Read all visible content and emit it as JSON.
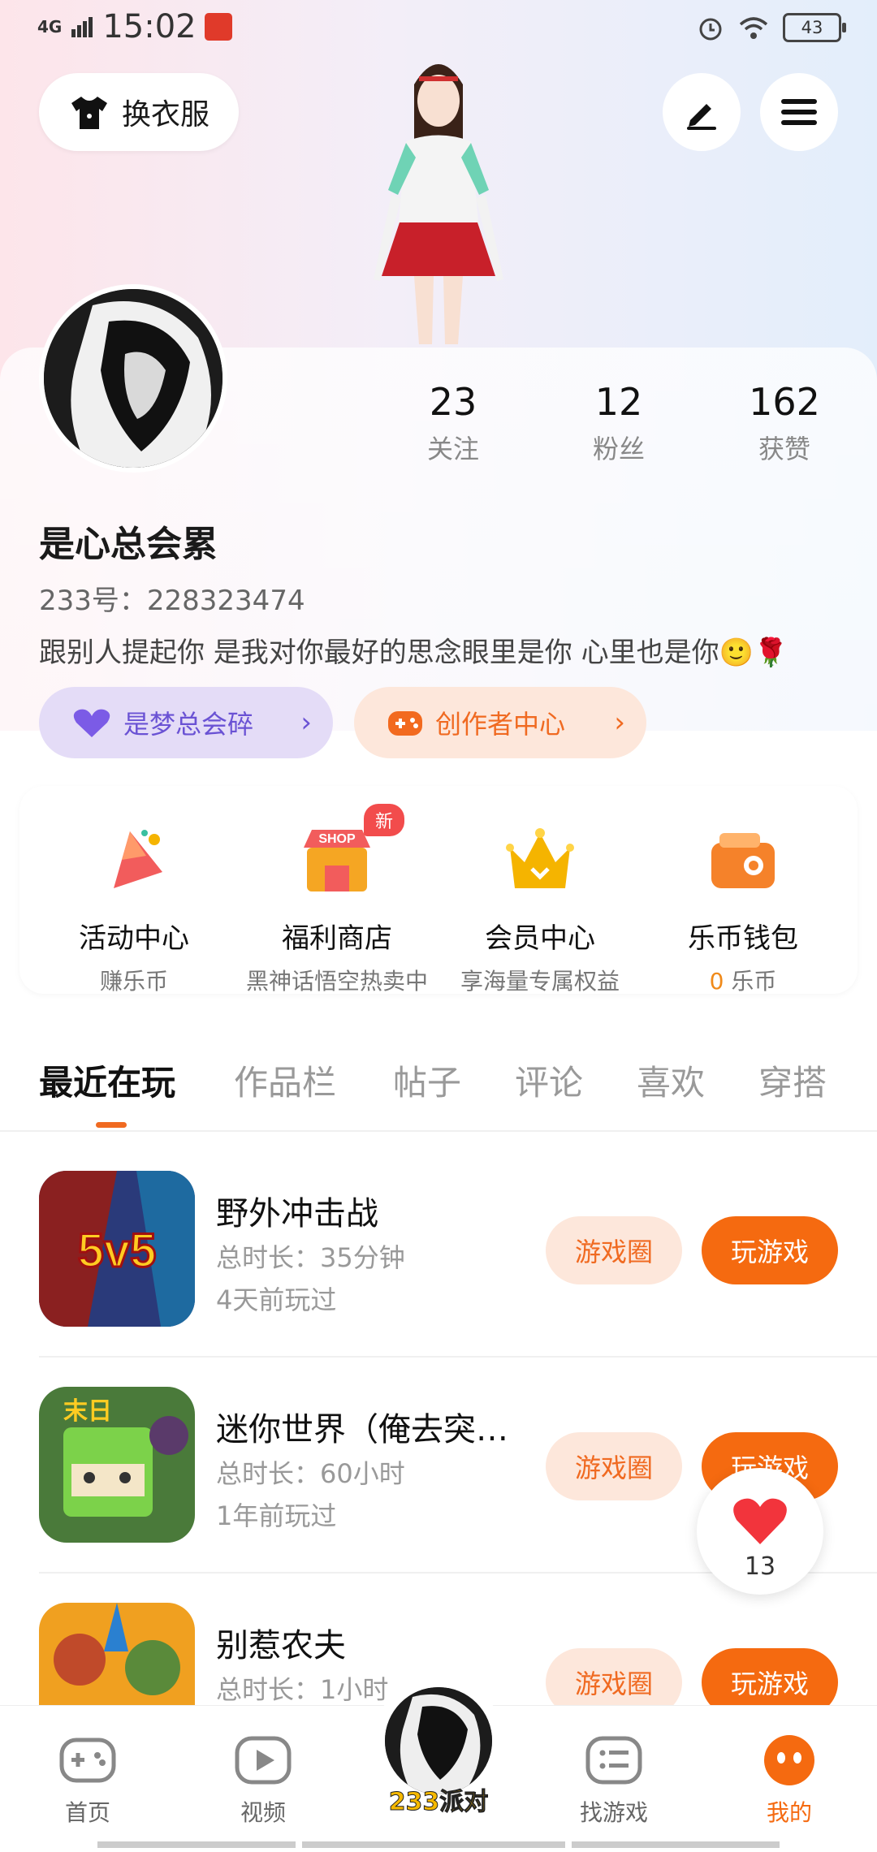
{
  "status_bar": {
    "network": "4G",
    "time": "15:02",
    "battery": "43"
  },
  "top": {
    "dress_label": "换衣服"
  },
  "profile": {
    "stats": [
      {
        "value": "23",
        "label": "关注"
      },
      {
        "value": "12",
        "label": "粉丝"
      },
      {
        "value": "162",
        "label": "获赞"
      }
    ],
    "nickname": "是心总会累",
    "uid": "233号：228323474",
    "bio": "跟别人提起你 是我对你最好的思念眼里是你 心里也是你🙂🌹",
    "guild_label": "是梦总会碎",
    "creator_label": "创作者中心"
  },
  "features": [
    {
      "title": "活动中心",
      "sub": "赚乐币",
      "icon": "party-icon"
    },
    {
      "title": "福利商店",
      "sub": "黑神话悟空热卖中",
      "icon": "shop-icon",
      "badge": "新"
    },
    {
      "title": "会员中心",
      "sub": "享海量专属权益",
      "icon": "crown-icon"
    },
    {
      "title": "乐币钱包",
      "sub_value": "0",
      "sub_unit": "乐币",
      "icon": "wallet-icon"
    }
  ],
  "features_shop_badge": "新",
  "shop_sign": "SHOP",
  "tabs": [
    "最近在玩",
    "作品栏",
    "帖子",
    "评论",
    "喜欢",
    "穿搭"
  ],
  "games": [
    {
      "name": "野外冲击战",
      "duration": "总时长：35分钟",
      "ago": "4天前玩过",
      "circle": "游戏圈",
      "play": "玩游戏",
      "art": "5v5"
    },
    {
      "name": "迷你世界（俺去突…",
      "duration": "总时长：60小时",
      "ago": "1年前玩过",
      "circle": "游戏圈",
      "play": "玩游戏",
      "art": "末日"
    },
    {
      "name": "别惹农夫",
      "duration": "总时长：1小时",
      "ago": "",
      "circle": "游戏圈",
      "play": "玩游戏",
      "art": ""
    }
  ],
  "like_fab": {
    "count": "13"
  },
  "nav": [
    {
      "label": "首页",
      "icon": "gamepad-icon"
    },
    {
      "label": "视频",
      "icon": "play-icon"
    },
    {
      "label": "233派对",
      "icon": "avatar"
    },
    {
      "label": "找游戏",
      "icon": "list-icon"
    },
    {
      "label": "我的",
      "icon": "profile-icon"
    }
  ],
  "colors": {
    "accent": "#f56a10",
    "guild": "#6a52d4"
  }
}
